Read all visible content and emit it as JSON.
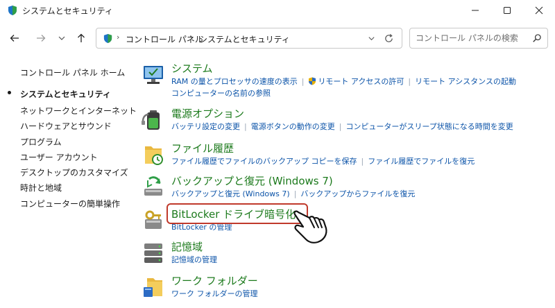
{
  "window": {
    "title": "システムとセキュリティ",
    "icons": [
      "control-panel-icon",
      "minimize-icon",
      "maximize-icon",
      "close-icon"
    ]
  },
  "nav": {
    "breadcrumbs": [
      "コントロール パネル",
      "システムとセキュリティ"
    ],
    "search_placeholder": "コントロール パネルの検索"
  },
  "sidebar": {
    "home": "コントロール パネル ホーム",
    "items": [
      {
        "label": "システムとセキュリティ",
        "current": true
      },
      {
        "label": "ネットワークとインターネット",
        "current": false
      },
      {
        "label": "ハードウェアとサウンド",
        "current": false
      },
      {
        "label": "プログラム",
        "current": false
      },
      {
        "label": "ユーザー アカウント",
        "current": false
      },
      {
        "label": "デスクトップのカスタマイズ",
        "current": false
      },
      {
        "label": "時計と地域",
        "current": false
      },
      {
        "label": "コンピューターの簡単操作",
        "current": false
      }
    ]
  },
  "categories": [
    {
      "title": "システム",
      "icon": "system-monitor-icon",
      "links": [
        {
          "label": "RAM の量とプロセッサの速度の表示"
        },
        {
          "label": "リモート アクセスの許可",
          "shield": true
        },
        {
          "label": "リモート アシスタンスの起動"
        },
        {
          "label": "コンピューターの名前の参照"
        }
      ]
    },
    {
      "title": "電源オプション",
      "icon": "power-battery-icon",
      "links": [
        {
          "label": "バッテリ設定の変更"
        },
        {
          "label": "電源ボタンの動作の変更"
        },
        {
          "label": "コンピューターがスリープ状態になる時間を変更"
        }
      ]
    },
    {
      "title": "ファイル履歴",
      "icon": "file-history-icon",
      "links": [
        {
          "label": "ファイル履歴でファイルのバックアップ コピーを保存"
        },
        {
          "label": "ファイル履歴でファイルを復元"
        }
      ]
    },
    {
      "title": "バックアップと復元 (Windows 7)",
      "icon": "backup-restore-icon",
      "links": [
        {
          "label": "バックアップと復元 (Windows 7)"
        },
        {
          "label": "バックアップからファイルを復元"
        }
      ]
    },
    {
      "title": "BitLocker ドライブ暗号化",
      "icon": "bitlocker-key-icon",
      "links": [
        {
          "label": "BitLocker の管理"
        }
      ]
    },
    {
      "title": "記憶域",
      "icon": "storage-drives-icon",
      "links": [
        {
          "label": "記憶域の管理"
        }
      ]
    },
    {
      "title": "ワーク フォルダー",
      "icon": "work-folders-icon",
      "links": [
        {
          "label": "ワーク フォルダーの管理"
        }
      ]
    }
  ],
  "colors": {
    "category_title": "#1c7a1c",
    "link": "#0b53a8",
    "highlight": "#c0392b"
  }
}
